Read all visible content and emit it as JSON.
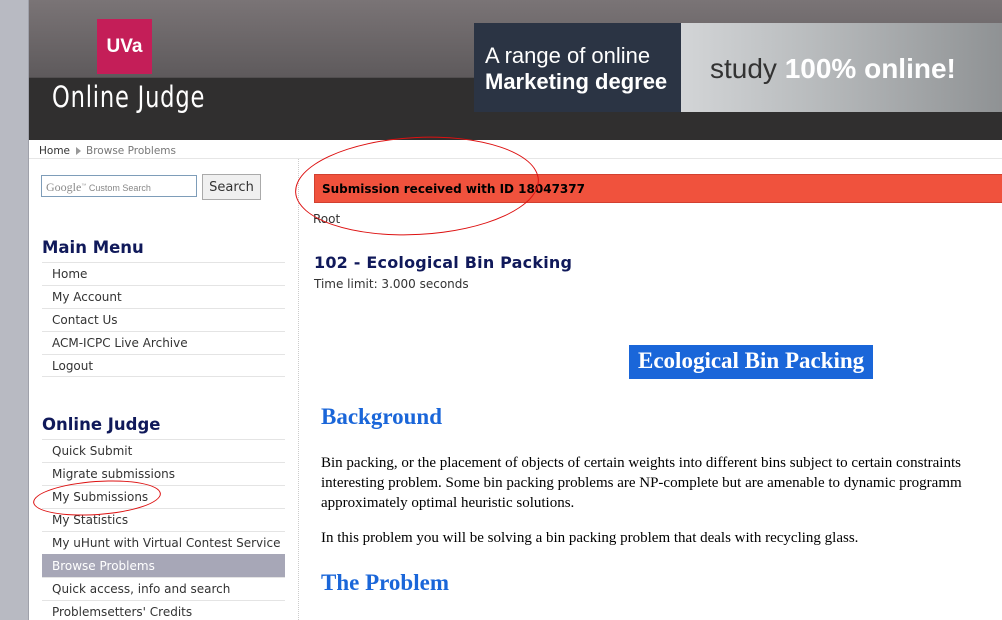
{
  "header": {
    "logo_text": "UVa",
    "site_title": "Online Judge",
    "ad": {
      "line1": "A range of online",
      "line2": "Marketing degree",
      "right_text_plain": "study ",
      "right_text_bold": "100% online!"
    }
  },
  "breadcrumb": {
    "home": "Home",
    "current": "Browse Problems"
  },
  "search": {
    "google_label": "Google",
    "placeholder_text": "Custom Search",
    "button": "Search"
  },
  "main_menu": {
    "title": "Main Menu",
    "items": [
      "Home",
      "My Account",
      "Contact Us",
      "ACM-ICPC Live Archive",
      "Logout"
    ]
  },
  "online_judge_menu": {
    "title": "Online Judge",
    "items": [
      "Quick Submit",
      "Migrate submissions",
      "My Submissions",
      "My Statistics",
      "My uHunt with Virtual Contest Service",
      "Browse Problems",
      "Quick access, info and search",
      "Problemsetters' Credits"
    ],
    "active": "Browse Problems"
  },
  "main": {
    "notice": "Submission received with ID 18047377",
    "root": "Root",
    "problem_title": "102 - Ecological Bin Packing",
    "time_limit": "Time limit: 3.000 seconds",
    "statement_title": "Ecological Bin Packing",
    "background_heading": "Background",
    "background_lines": [
      "Bin packing, or the placement of objects of certain weights into different bins subject to certain constraints",
      "interesting problem. Some bin packing problems are NP-complete but are amenable to dynamic programm",
      "approximately optimal heuristic solutions."
    ],
    "background_para2": "In this problem you will be solving a bin packing problem that deals with recycling glass.",
    "problem_heading": "The Problem"
  },
  "colors": {
    "notice_bg": "#f0523d",
    "heading_blue": "#1a66d9",
    "menu_title": "#10195a",
    "annotation": "#dd1111",
    "logo_bg": "#c41e58"
  }
}
